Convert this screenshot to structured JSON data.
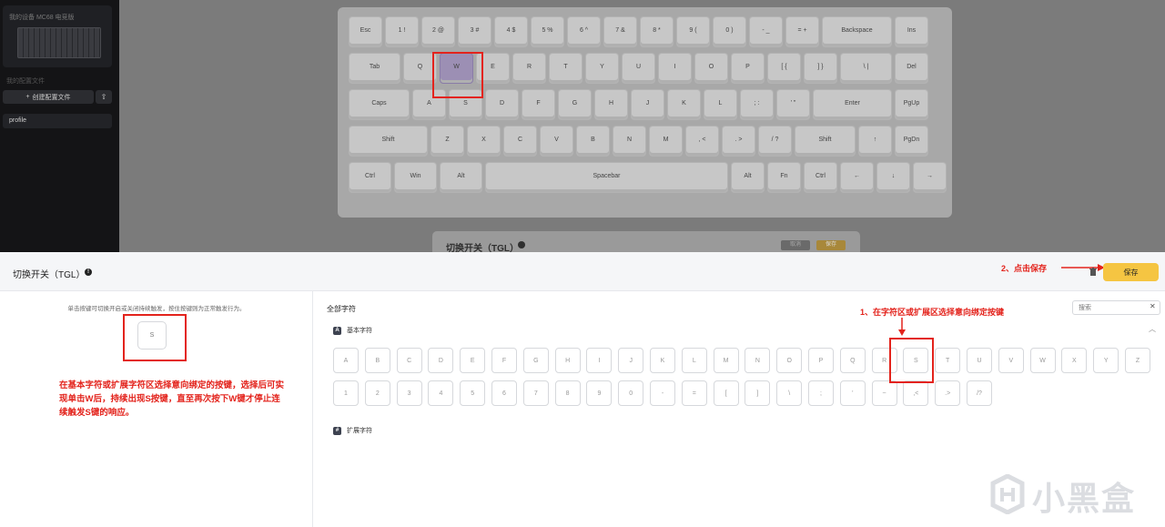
{
  "sidebar": {
    "device_title": "我的设备 MC68 电竞版",
    "section_label": "我的配置文件",
    "create_label": "创建配置文件",
    "import_icon": "upload-icon",
    "profile_name": "profile"
  },
  "keyboard": {
    "rows": [
      [
        "Esc",
        "1 !",
        "2 @",
        "3 #",
        "4 $",
        "5 %",
        "6 ^",
        "7 &",
        "8 *",
        "9 (",
        "0 )",
        "- _",
        "= +",
        "Backspace",
        "Ins"
      ],
      [
        "Tab",
        "Q",
        "W",
        "E",
        "R",
        "T",
        "Y",
        "U",
        "I",
        "O",
        "P",
        "[ {",
        "] }",
        "\\ |",
        "Del"
      ],
      [
        "Caps",
        "A",
        "S",
        "D",
        "F",
        "G",
        "H",
        "J",
        "K",
        "L",
        "; :",
        "' \"",
        "Enter",
        "PgUp"
      ],
      [
        "Shift",
        "Z",
        "X",
        "C",
        "V",
        "B",
        "N",
        "M",
        ", <",
        ". >",
        "/ ?",
        "Shift",
        "↑",
        "PgDn"
      ],
      [
        "Ctrl",
        "Win",
        "Alt",
        "Spacebar",
        "Alt",
        "Fn",
        "Ctrl",
        "←",
        "↓",
        "→"
      ]
    ],
    "selected_key": "W"
  },
  "ghost_panel": {
    "title": "切换开关（TGL）",
    "btn1": "取消",
    "btn2": "保存"
  },
  "panel": {
    "title": "切换开关（TGL）",
    "save_hint": "2、点击保存",
    "save_label": "保存"
  },
  "left": {
    "description": "单击按键可切换开启或关闭持续触发，按住按键则为正常触发行为。",
    "target_key": "S",
    "explanation": "在基本字符或扩展字符区选择意向绑定的按键，选择后可实现单击W后，持续出现S按键，直至再次按下W键才停止连续触发S键的响应。"
  },
  "right": {
    "all_chars_label": "全部字符",
    "step1_hint": "1、在字符区或扩展区选择意向绑定按键",
    "search_placeholder": "搜索",
    "basic_label": "基本字符",
    "basic_icon": "A",
    "ext_label": "扩展字符",
    "ext_icon": "#",
    "letters": [
      "A",
      "B",
      "C",
      "D",
      "E",
      "F",
      "G",
      "H",
      "I",
      "J",
      "K",
      "L",
      "M",
      "N",
      "O",
      "P",
      "Q",
      "R",
      "S",
      "T",
      "U",
      "V",
      "W",
      "X",
      "Y",
      "Z"
    ],
    "symbols": [
      "1",
      "2",
      "3",
      "4",
      "5",
      "6",
      "7",
      "8",
      "9",
      "0",
      "-",
      "=",
      "[",
      "]",
      "\\",
      ";",
      "'",
      "~",
      ",<",
      ".>",
      "/?"
    ],
    "selected_char": "S"
  },
  "watermark": "小黑盒",
  "colors": {
    "accent": "#f5c542",
    "annotation": "#e3231c",
    "selected_key": "#9c8fb4"
  }
}
